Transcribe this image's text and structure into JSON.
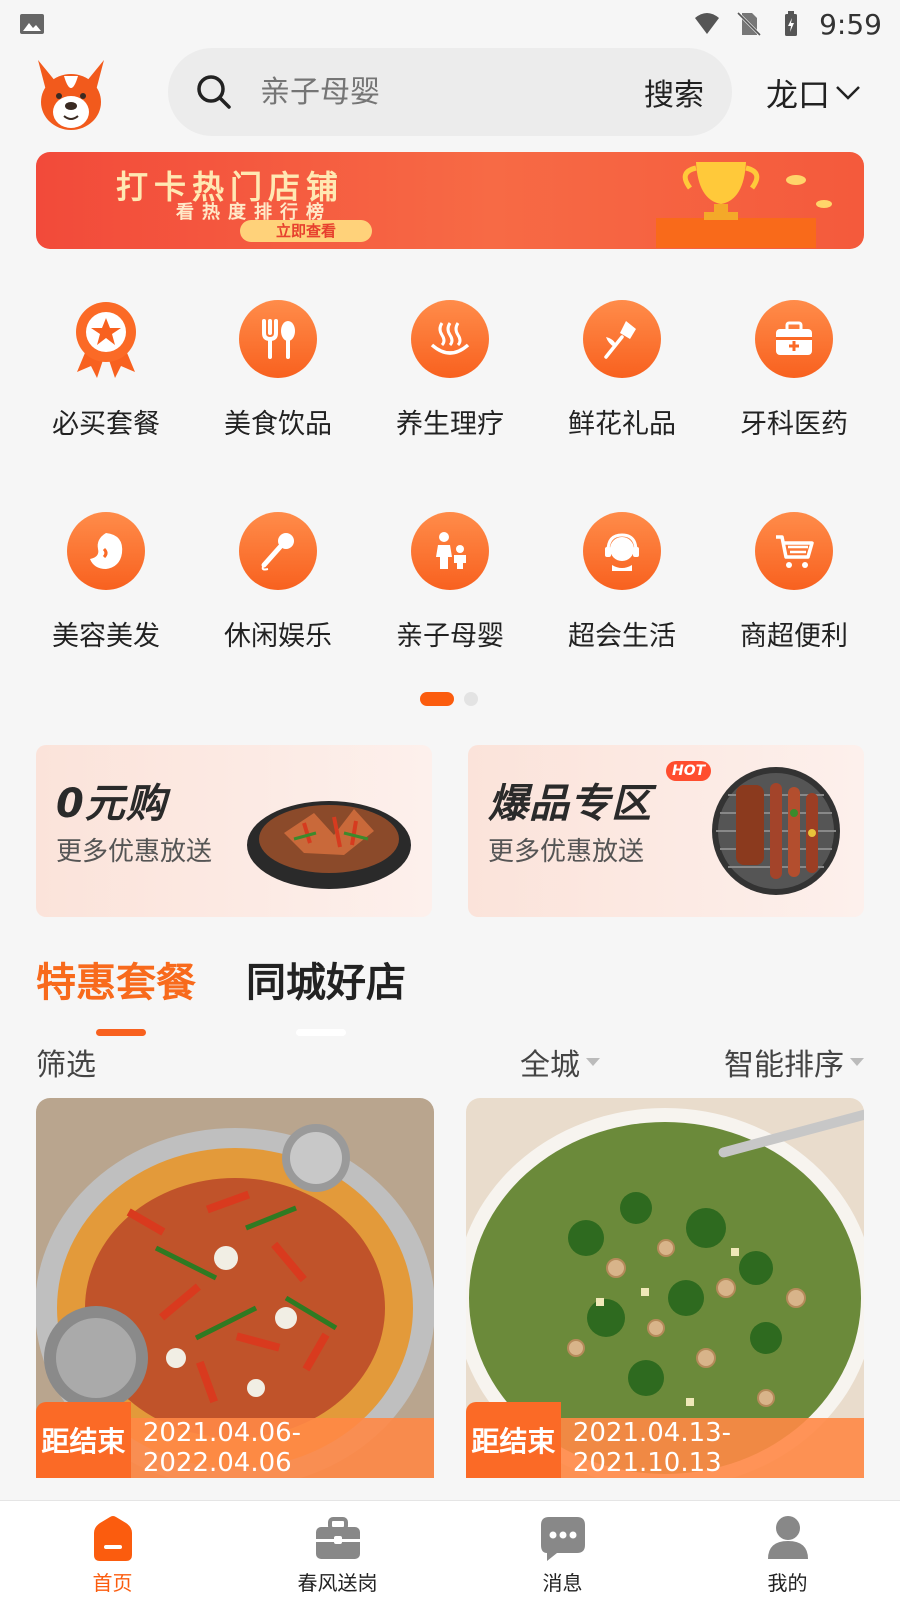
{
  "status_bar": {
    "time": "9:59"
  },
  "header": {
    "search_placeholder": "亲子母婴",
    "search_button": "搜索",
    "location": "龙口"
  },
  "banner": {
    "title": "打卡热门店铺",
    "subtitle": "看热度排行榜",
    "button": "立即查看"
  },
  "categories": [
    {
      "label": "必买套餐",
      "icon": "badge-star-icon"
    },
    {
      "label": "美食饮品",
      "icon": "fork-spoon-icon"
    },
    {
      "label": "养生理疗",
      "icon": "spa-steam-icon"
    },
    {
      "label": "鲜花礼品",
      "icon": "flower-icon"
    },
    {
      "label": "牙科医药",
      "icon": "medical-kit-icon"
    },
    {
      "label": "美容美发",
      "icon": "face-profile-icon"
    },
    {
      "label": "休闲娱乐",
      "icon": "microphone-icon"
    },
    {
      "label": "亲子母婴",
      "icon": "parent-child-icon"
    },
    {
      "label": "超会生活",
      "icon": "headset-user-icon"
    },
    {
      "label": "商超便利",
      "icon": "shopping-cart-icon"
    }
  ],
  "promos": {
    "left": {
      "title": "0元购",
      "subtitle": "更多优惠放送"
    },
    "right": {
      "title": "爆品专区",
      "badge": "HOT",
      "subtitle": "更多优惠放送"
    }
  },
  "tabs": {
    "active": "特惠套餐",
    "inactive": "同城好店"
  },
  "filters": {
    "label": "筛选",
    "city": "全城",
    "sort": "智能排序"
  },
  "cards": [
    {
      "end_label": "距结束",
      "date_range": "2021.04.06-2022.04.06"
    },
    {
      "end_label": "距结束",
      "date_range": "2021.04.13-2021.10.13"
    }
  ],
  "tabbar": [
    {
      "label": "首页",
      "icon": "home-icon",
      "active": true
    },
    {
      "label": "春风送岗",
      "icon": "briefcase-icon",
      "active": false
    },
    {
      "label": "消息",
      "icon": "chat-icon",
      "active": false
    },
    {
      "label": "我的",
      "icon": "user-icon",
      "active": false
    }
  ],
  "colors": {
    "accent": "#fb5c0e",
    "accent_gradient_top": "#ff8c4a",
    "banner_red": "#f24a3a"
  }
}
